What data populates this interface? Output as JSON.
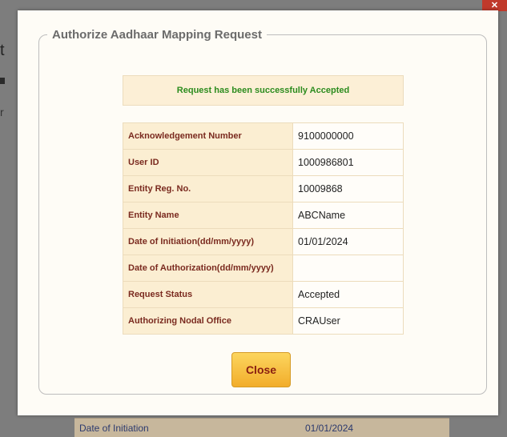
{
  "background": {
    "fragment_t": "t",
    "fragment_r": "r",
    "row_label": "Date of Initiation",
    "row_value": "01/01/2024",
    "close_icon": "x-icon"
  },
  "dialog": {
    "title": "Authorize Aadhaar Mapping Request",
    "success_message": "Request has been successfully Accepted",
    "rows": [
      {
        "label": "Acknowledgement Number",
        "value": "9100000000"
      },
      {
        "label": "User ID",
        "value": "1000986801"
      },
      {
        "label": "Entity Reg. No.",
        "value": "10009868"
      },
      {
        "label": "Entity Name",
        "value": "ABCName"
      },
      {
        "label": "Date of Initiation(dd/mm/yyyy)",
        "value": "01/01/2024"
      },
      {
        "label": "Date of Authorization(dd/mm/yyyy)",
        "value": ""
      },
      {
        "label": "Request Status",
        "value": "Accepted"
      },
      {
        "label": "Authorizing Nodal Office",
        "value": "CRAUser"
      }
    ],
    "close_label": "Close"
  },
  "colors": {
    "success_text": "#2c8c1e",
    "label_text": "#7a2a1f",
    "button_gradient_top": "#fcd55e",
    "button_gradient_bottom": "#f2ad2b"
  }
}
